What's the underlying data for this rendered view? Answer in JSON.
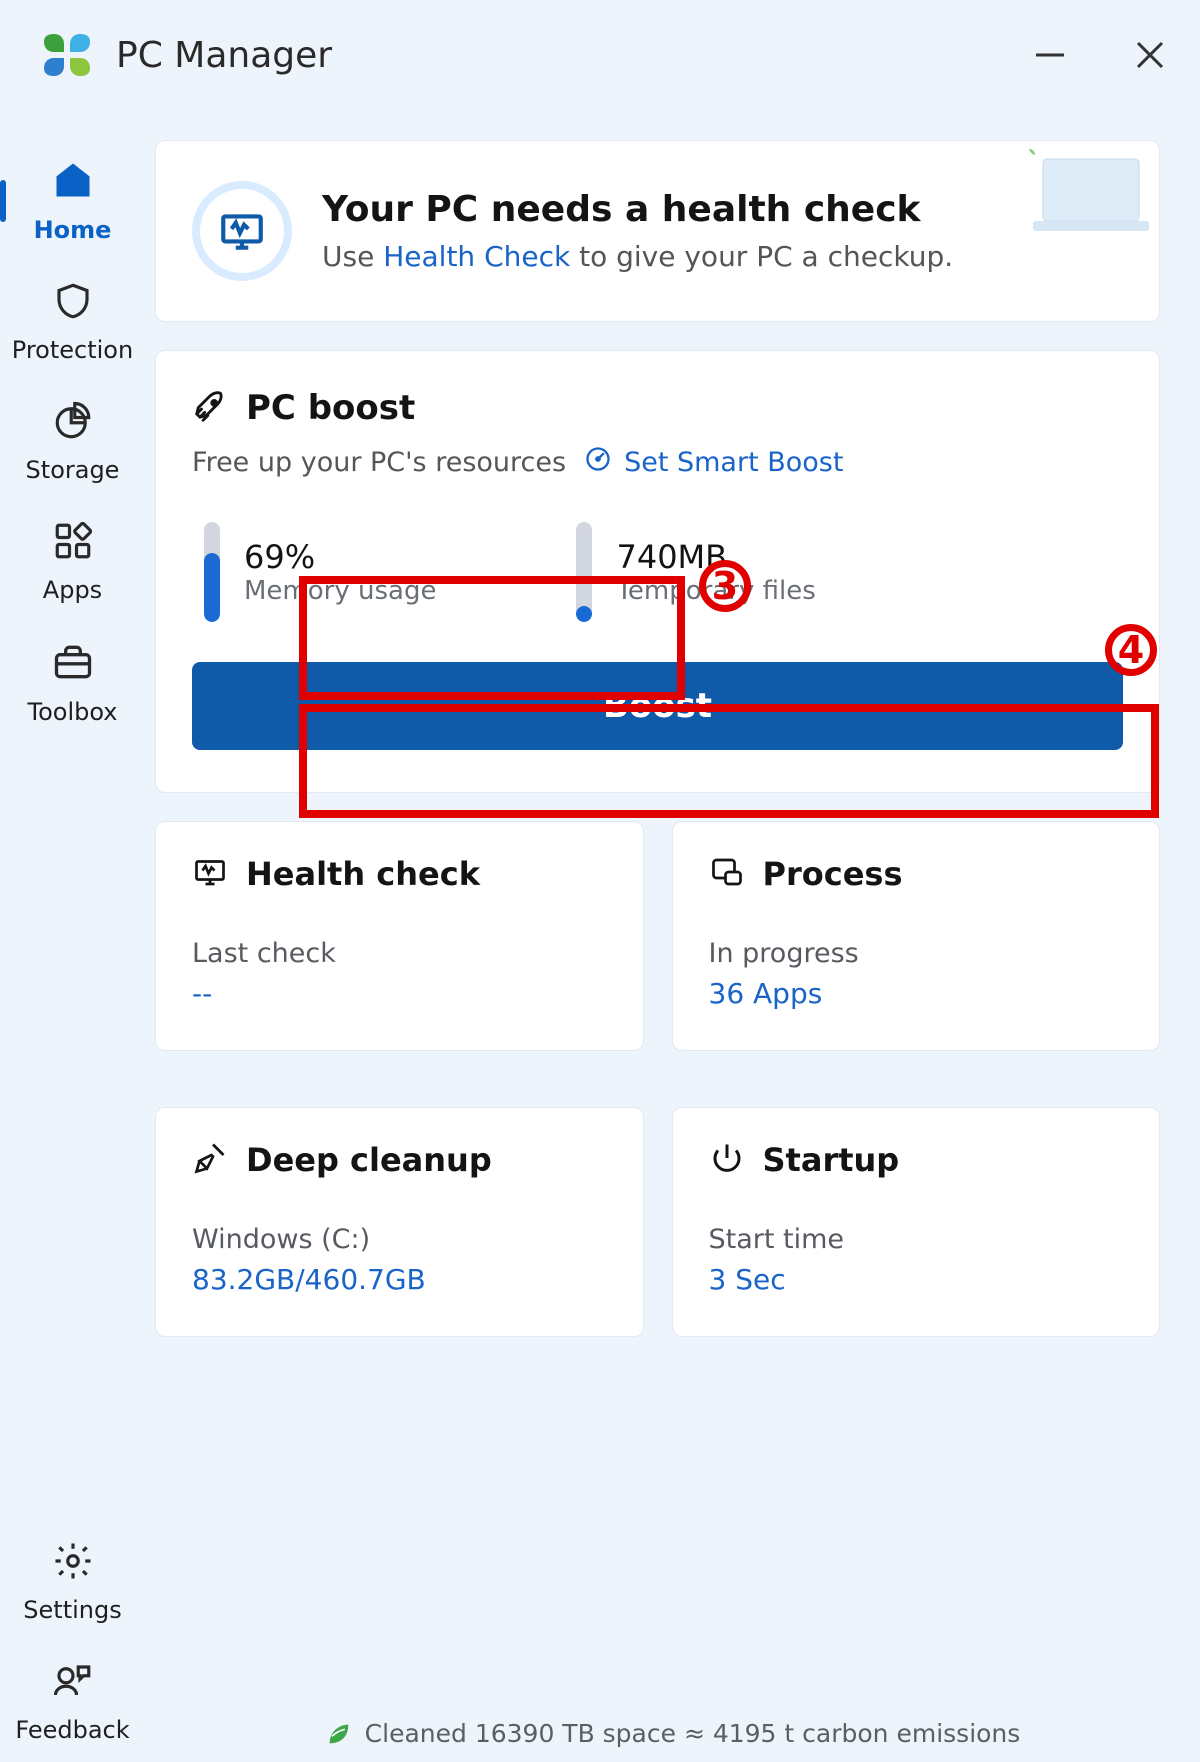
{
  "app_title": "PC Manager",
  "sidebar": {
    "items": [
      {
        "label": "Home"
      },
      {
        "label": "Protection"
      },
      {
        "label": "Storage"
      },
      {
        "label": "Apps"
      },
      {
        "label": "Toolbox"
      }
    ],
    "settings_label": "Settings",
    "feedback_label": "Feedback"
  },
  "health_banner": {
    "title": "Your PC needs a health check",
    "prefix": "Use ",
    "link": "Health Check",
    "suffix": " to give your PC a checkup."
  },
  "pc_boost": {
    "title": "PC boost",
    "subtitle": "Free up your PC's resources",
    "smart_boost": "Set Smart Boost",
    "memory": {
      "value": "69%",
      "label": "Memory usage"
    },
    "temp": {
      "value": "740MB",
      "label": "Temporary files"
    },
    "button": "Boost"
  },
  "cards": {
    "health": {
      "title": "Health check",
      "label": "Last check",
      "value": "--"
    },
    "process": {
      "title": "Process",
      "label": "In progress",
      "value": "36 Apps"
    },
    "cleanup": {
      "title": "Deep cleanup",
      "label": "Windows (C:)",
      "value": "83.2GB/460.7GB"
    },
    "startup": {
      "title": "Startup",
      "label": "Start time",
      "value": "3 Sec"
    }
  },
  "footer": "Cleaned 16390 TB space ≈ 4195 t carbon emissions",
  "annotations": {
    "n3": "3",
    "n4": "4"
  }
}
